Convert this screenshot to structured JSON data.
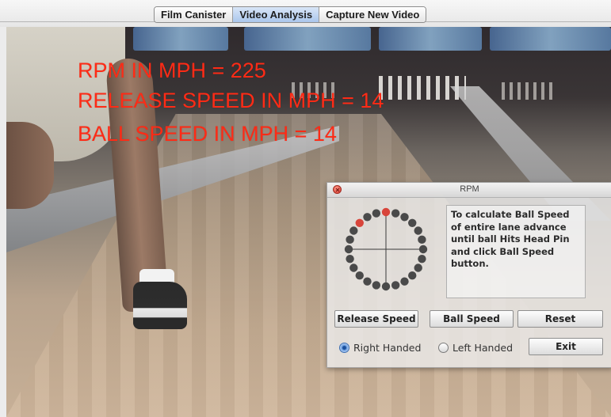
{
  "tabs": [
    {
      "label": "Film Canister",
      "selected": false
    },
    {
      "label": "Video Analysis",
      "selected": true
    },
    {
      "label": "Capture New Video",
      "selected": false
    }
  ],
  "overlay": {
    "line1": "RPM IN MPH = 225",
    "line2": "RELEASE SPEED IN MPH = 14",
    "line3": "BALL SPEED IN MPH = 14",
    "color": "#ff2b16"
  },
  "dialog": {
    "title": "RPM",
    "instructions": "To calculate Ball Speed of entire lane advance until ball Hits Head Pin and click Ball Speed button.",
    "buttons": {
      "release_speed": "Release Speed",
      "ball_speed": "Ball Speed",
      "reset": "Reset",
      "exit": "Exit"
    },
    "handedness": {
      "right": "Right Handed",
      "left": "Left Handed",
      "selected": "right"
    },
    "dial": {
      "dot_count": 24,
      "highlighted_dots": [
        0,
        21
      ],
      "dot_color": "#4a4a4a",
      "highlight_color": "#d8453b"
    }
  },
  "icons": {
    "close": "close-icon",
    "dial": "rpm-dial-icon"
  },
  "colors": {
    "accent_tab": "#aac6ec",
    "readout_red": "#ff2b16"
  }
}
